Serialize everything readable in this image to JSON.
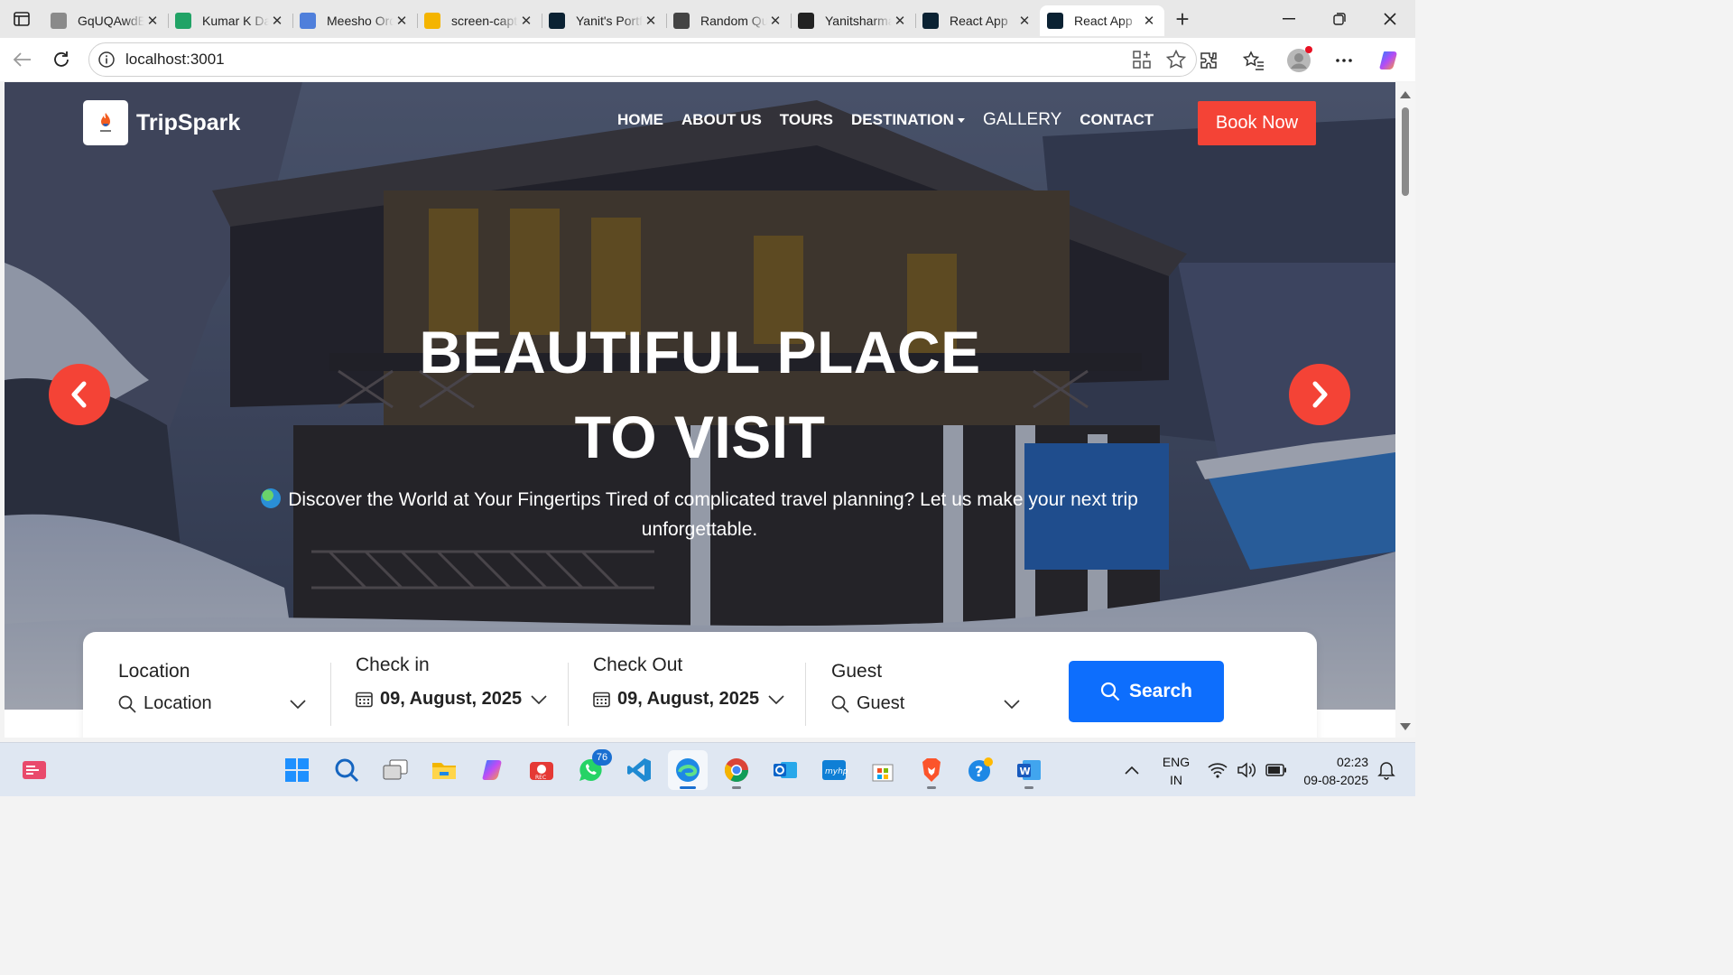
{
  "browser": {
    "tabs": [
      {
        "title": "GqUQAwdEe",
        "favicon": "ideone-icon",
        "color": "#8a8a8a"
      },
      {
        "title": "Kumar K Data",
        "favicon": "sheets-icon",
        "color": "#21a366"
      },
      {
        "title": "Meesho Order",
        "favicon": "docs-icon",
        "color": "#4f7fdb"
      },
      {
        "title": "screen-capture",
        "favicon": "drive-icon",
        "color": "#f4b400"
      },
      {
        "title": "Yanit's Portfolio",
        "favicon": "react-icon",
        "color": "#0b2233"
      },
      {
        "title": "Random Quote",
        "favicon": "globe-icon",
        "color": "#444"
      },
      {
        "title": "Yanitsharma",
        "favicon": "github-icon",
        "color": "#222"
      },
      {
        "title": "React App",
        "favicon": "react-icon",
        "color": "#0b2233"
      },
      {
        "title": "React App",
        "favicon": "react-icon",
        "color": "#0b2233",
        "active": true
      }
    ],
    "url": "localhost:3001"
  },
  "site": {
    "brand": "TripSpark",
    "nav": {
      "home": "HOME",
      "about": "ABOUT US",
      "tours": "TOURS",
      "destination": "DESTINATION",
      "gallery": "GALLERY",
      "contact": "CONTACT"
    },
    "book_now": "Book Now",
    "hero": {
      "title_line1": "BEAUTIFUL PLACE",
      "title_line2": "TO VISIT",
      "subtitle": "Discover the World at Your Fingertips Tired of complicated travel planning? Let us make your next trip unforgettable."
    },
    "search": {
      "location_label": "Location",
      "location_placeholder": "Location",
      "checkin_label": "Check in",
      "checkin_value": "09, August, 2025",
      "checkout_label": "Check Out",
      "checkout_value": "09, August, 2025",
      "guest_label": "Guest",
      "guest_placeholder": "Guest",
      "button": "Search"
    },
    "colors": {
      "accent": "#f44336",
      "primary": "#0d6efd"
    }
  },
  "taskbar": {
    "whatsapp_badge": "76",
    "lang_line1": "ENG",
    "lang_line2": "IN",
    "time": "02:23",
    "date": "09-08-2025"
  }
}
